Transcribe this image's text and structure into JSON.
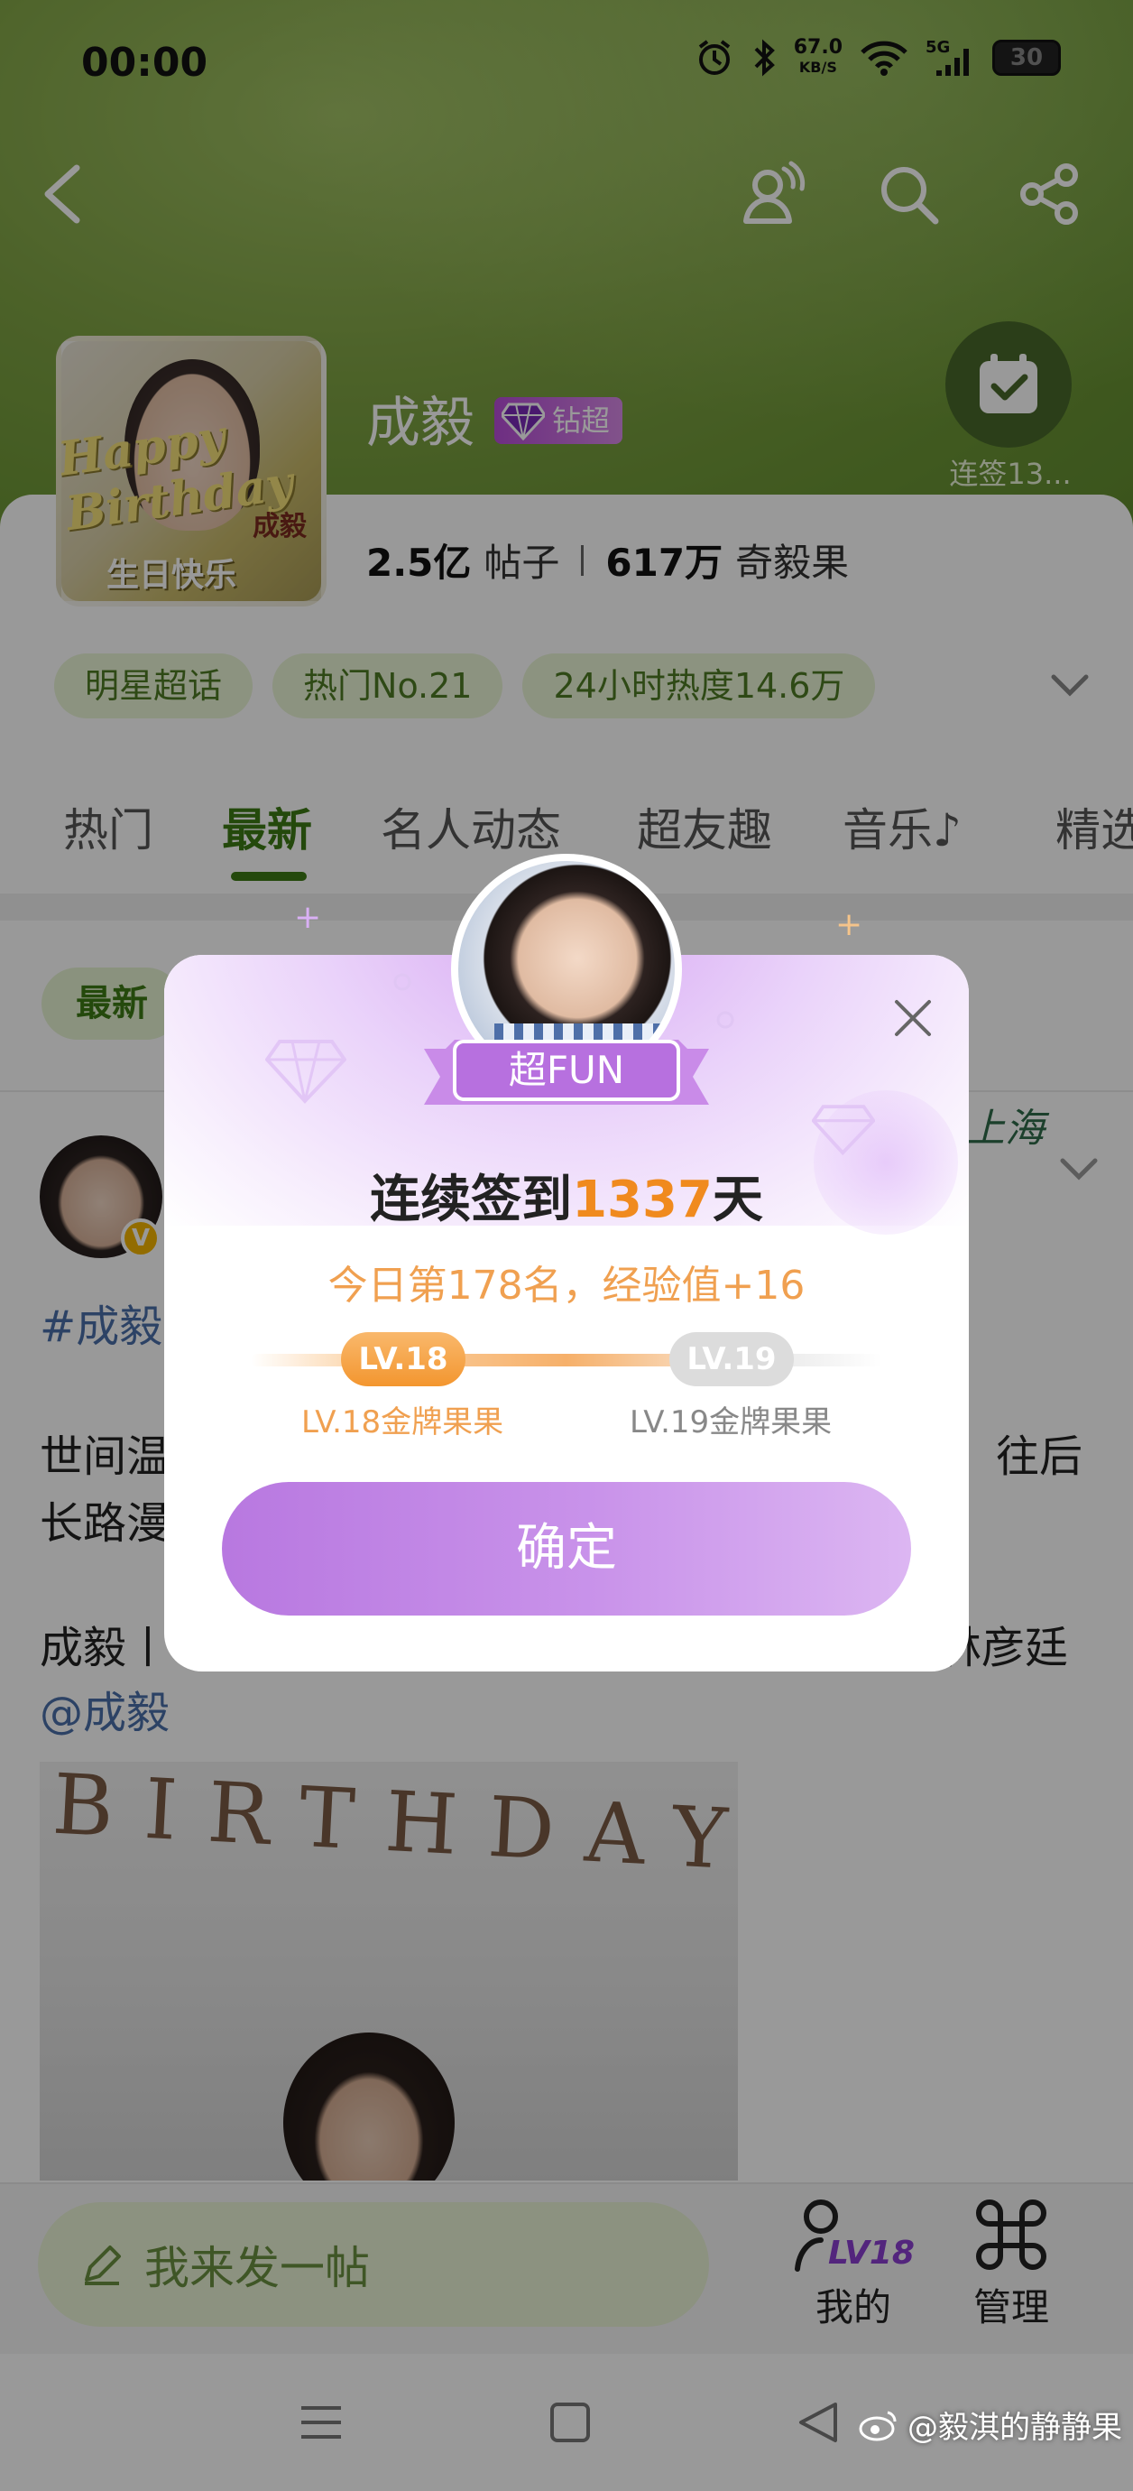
{
  "status_bar": {
    "time": "00:00",
    "net_speed_value": "67.0",
    "net_speed_unit": "KB/S",
    "network": "5G",
    "battery": "30"
  },
  "header": {
    "back_icon": "chevron-left-icon",
    "icons": [
      "people-icon",
      "search-icon",
      "share-icon"
    ]
  },
  "topic": {
    "name": "成毅",
    "badge": "钻超",
    "checkin_label": "连签13...",
    "stats": {
      "posts_value": "2.5亿",
      "posts_label": "帖子",
      "fans_value": "617万",
      "fans_label": "奇毅果"
    },
    "cover": {
      "overlay_text": "Happy Birthday",
      "bday_cn": "生日快乐",
      "name_tag": "成毅"
    },
    "tags": [
      "明星超话",
      "热门No.21",
      "24小时热度14.6万"
    ]
  },
  "tabs": [
    {
      "label": "热门",
      "active": false
    },
    {
      "label": "最新",
      "active": true
    },
    {
      "label": "名人动态",
      "active": false
    },
    {
      "label": "超友趣",
      "active": false
    },
    {
      "label": "音乐♪",
      "active": false
    },
    {
      "label": "精选",
      "active": false
    }
  ],
  "filter_chip": "最新",
  "post": {
    "hashtag": "#成毅",
    "line1_start": "世间温",
    "line1_end": "往后",
    "line2_start": "长路漫",
    "line3_start": "成毅丨",
    "line3_end": "林彦廷",
    "mention": "@成毅",
    "logo": "上海",
    "v_badge": "V",
    "image_letters": "BIRTHDAY"
  },
  "bottom": {
    "post_placeholder": "我来发一帖",
    "mine_label": "我的",
    "mine_level": "LV18",
    "manage_label": "管理"
  },
  "watermark": "@毅淇的静静果",
  "modal": {
    "ribbon": "超FUN",
    "title_prefix": "连续签到",
    "days": "1337",
    "title_suffix": "天",
    "rank_line": "今日第178名，经验值+16",
    "current_level": "LV.18",
    "next_level": "LV.19",
    "current_level_name": "LV.18金牌果果",
    "next_level_name": "LV.19金牌果果",
    "confirm": "确定"
  },
  "colors": {
    "accent_green": "#3c7a14",
    "modal_purple": "#c993ea",
    "highlight_orange": "#f08a1e"
  }
}
